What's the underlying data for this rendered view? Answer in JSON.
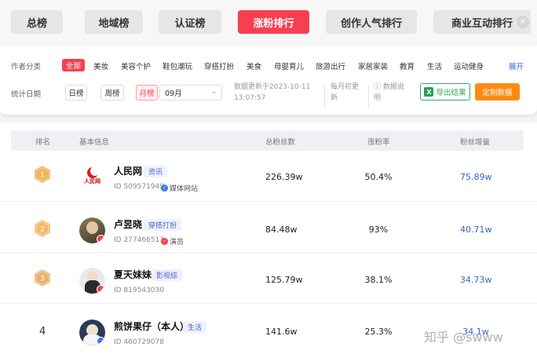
{
  "tabs": [
    "总榜",
    "地域榜",
    "认证榜",
    "涨粉排行",
    "创作人气排行",
    "商业互动排行"
  ],
  "filters": {
    "category_label": "作者分类",
    "categories": [
      "全部",
      "美妆",
      "美容个护",
      "鞋包潮玩",
      "穿搭打扮",
      "美食",
      "母婴育儿",
      "旅游出行",
      "家居家装",
      "教育",
      "生活",
      "运动健身"
    ],
    "expand": "展开",
    "date_label": "统计日期",
    "day": "日榜",
    "week": "周榜",
    "month": "月榜",
    "month_value": "09月",
    "update_line1": "数据更新于2023-10-11",
    "update_line2": "13:07:57",
    "note_line1": "每月初更",
    "note_line2": "新",
    "explain_line1": "数据说",
    "explain_line2": "明",
    "export": "导出结果",
    "custom": "定制数据"
  },
  "table": {
    "headers": [
      "排名",
      "基本信息",
      "总粉丝数",
      "涨粉率",
      "粉丝增量"
    ],
    "rows": [
      {
        "rank": "1",
        "name": "人民网",
        "tag": "资讯",
        "id": "ID 509571949",
        "cert": "媒体网站",
        "fans": "226.39w",
        "rate": "50.4%",
        "increase": "75.89w"
      },
      {
        "rank": "2",
        "name": "卢昱晓",
        "tag": "穿搭打扮",
        "id": "ID 277466513",
        "cert": "演员",
        "fans": "84.48w",
        "rate": "93%",
        "increase": "40.71w"
      },
      {
        "rank": "3",
        "name": "夏天妹妹",
        "tag": "影视综",
        "id": "ID 819543030",
        "cert": "",
        "fans": "125.79w",
        "rate": "38.1%",
        "increase": "34.73w"
      },
      {
        "rank": "4",
        "name": "煎饼果仔（本人）",
        "tag": "生活",
        "id": "ID 460729078",
        "cert": "",
        "fans": "141.6w",
        "rate": "25.3%",
        "increase": "34.1w"
      }
    ]
  },
  "avatar_logo_text": "人民网",
  "watermark": "知乎 @swww",
  "colors": {
    "accent": "#f6404f",
    "link": "#3b62c4",
    "export": "#3aa65c",
    "custom": "#ff8a12"
  }
}
